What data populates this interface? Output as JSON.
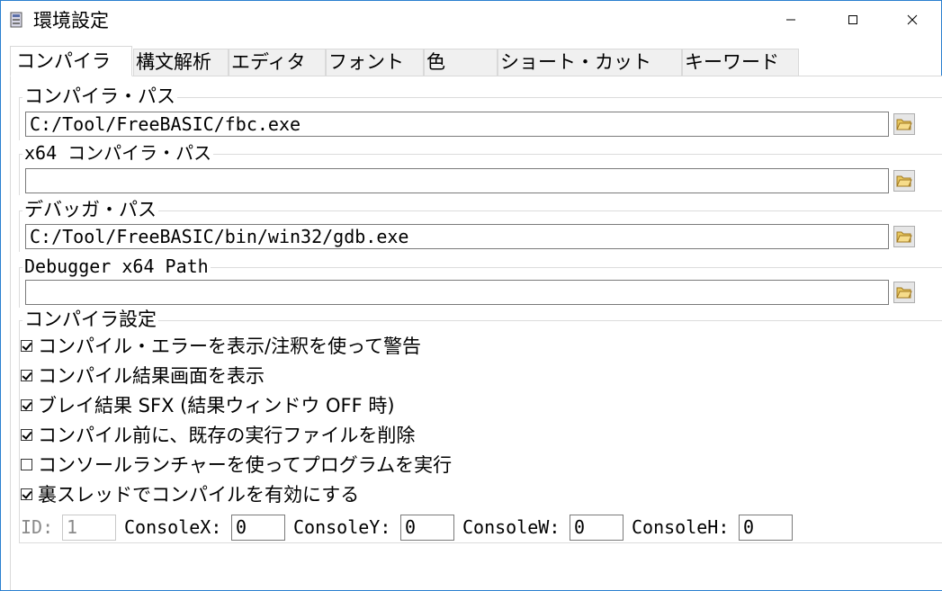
{
  "window": {
    "title": "環境設定"
  },
  "tabs": [
    "コンパイラ",
    "構文解析",
    "エディタ",
    "フォント",
    "色",
    "ショート・カット",
    "キーワード"
  ],
  "paths": {
    "compiler": {
      "label": "コンパイラ・パス",
      "value": "C:/Tool/FreeBASIC/fbc.exe"
    },
    "compiler_x64": {
      "label": "x64 コンパイラ・パス",
      "value": ""
    },
    "debugger": {
      "label": "デバッガ・パス",
      "value": "C:/Tool/FreeBASIC/bin/win32/gdb.exe"
    },
    "debugger_x64": {
      "label": "Debugger x64 Path",
      "value": ""
    }
  },
  "compiler_settings": {
    "label": "コンパイラ設定",
    "options": [
      {
        "label": "コンパイル・エラーを表示/注釈を使って警告",
        "checked": true
      },
      {
        "label": "コンパイル結果画面を表示",
        "checked": true
      },
      {
        "label": "ブレイ結果 SFX (結果ウィンドウ OFF 時)",
        "checked": true
      },
      {
        "label": "コンパイル前に、既存の実行ファイルを削除",
        "checked": true
      },
      {
        "label": "コンソールランチャーを使ってプログラムを実行",
        "checked": false
      },
      {
        "label": "裏スレッドでコンパイルを有効にする",
        "checked": true
      }
    ],
    "fields": {
      "id": {
        "label": "ID:",
        "value": "1"
      },
      "console_x": {
        "label": "ConsoleX:",
        "value": "0"
      },
      "console_y": {
        "label": "ConsoleY:",
        "value": "0"
      },
      "console_w": {
        "label": "ConsoleW:",
        "value": "0"
      },
      "console_h": {
        "label": "ConsoleH:",
        "value": "0"
      }
    }
  },
  "icons": {
    "app": "settings-app-icon",
    "browse": "open-folder-icon",
    "minimize": "minimize-icon",
    "maximize": "maximize-icon",
    "close": "close-icon"
  }
}
